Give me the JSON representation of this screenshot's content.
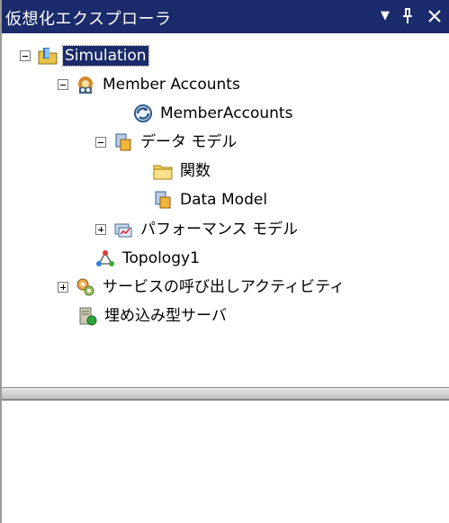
{
  "panel": {
    "title": "仮想化エクスプローラ",
    "buttons": {
      "dropdown": "▼",
      "pin": "ᵩ",
      "close": "✕"
    }
  },
  "tree": {
    "simulation": "Simulation",
    "member_accounts_group": "Member Accounts",
    "member_accounts_service": "MemberAccounts",
    "data_model_folder": "データ モデル",
    "functions_folder": "関数",
    "data_model_item": "Data Model",
    "performance_model": "パフォーマンス モデル",
    "topology": "Topology1",
    "service_call_activity": "サービスの呼び出しアクティビティ",
    "embedded_server": "埋め込み型サーバ"
  },
  "colors": {
    "title_bar": "#1b2b6b",
    "selection": "#1b2b6b"
  }
}
